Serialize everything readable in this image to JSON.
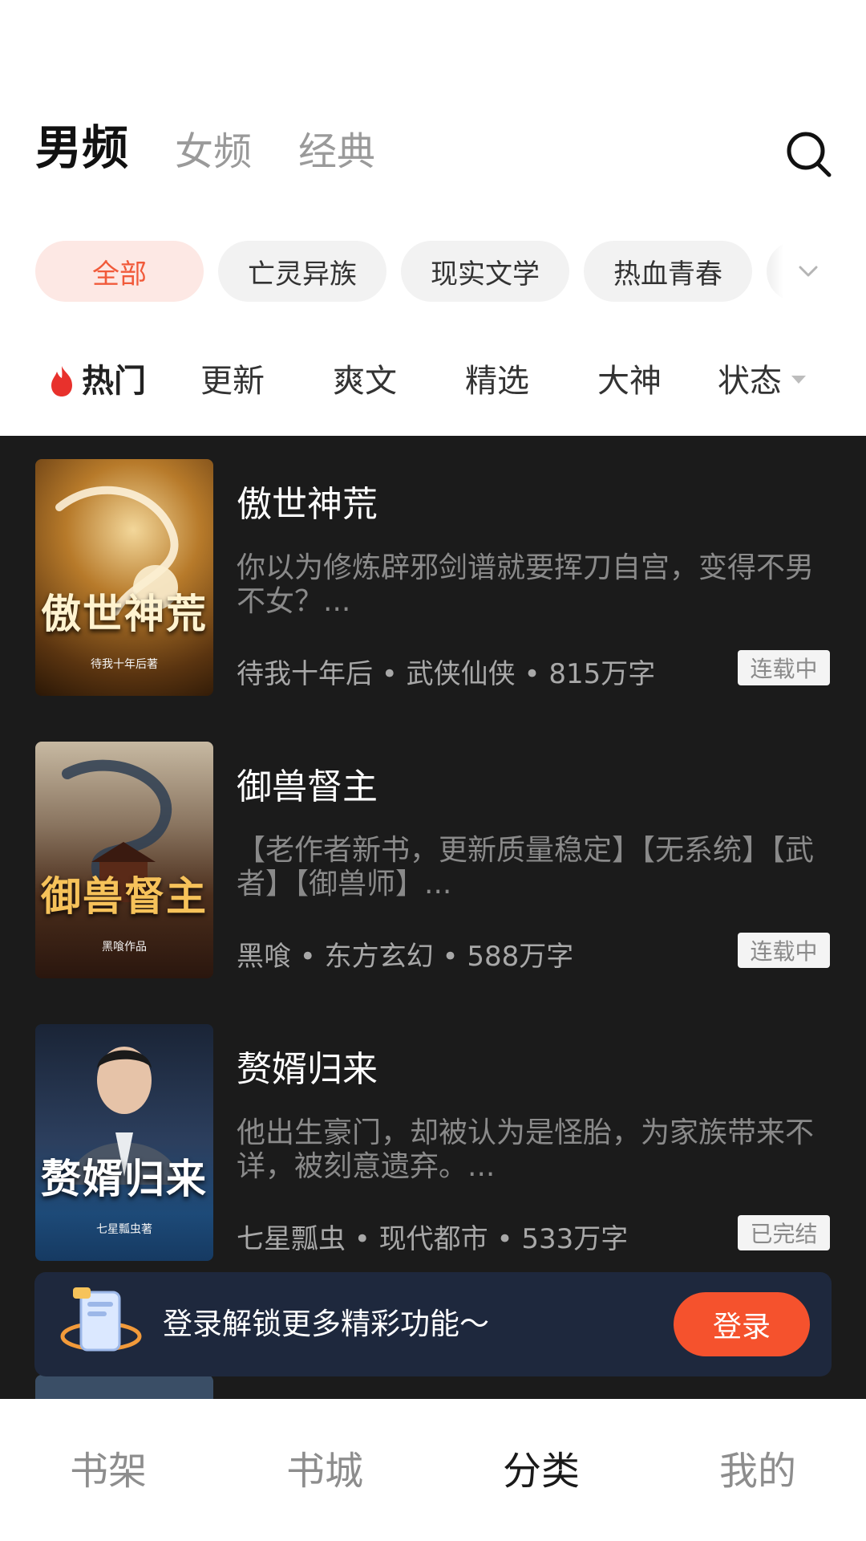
{
  "gender_tabs": [
    {
      "label": "男频",
      "active": true
    },
    {
      "label": "女频",
      "active": false
    },
    {
      "label": "经典",
      "active": false
    }
  ],
  "genre_chips": [
    {
      "label": "全部",
      "active": true
    },
    {
      "label": "亡灵异族",
      "active": false
    },
    {
      "label": "现实文学",
      "active": false
    },
    {
      "label": "热血青春",
      "active": false
    }
  ],
  "sort_tabs": {
    "hot": "热门",
    "update": "更新",
    "cool": "爽文",
    "featured": "精选",
    "master": "大神",
    "status": "状态"
  },
  "books": [
    {
      "title": "傲世神荒",
      "description": "你以为修炼辟邪剑谱就要挥刀自宫，变得不男不女？...",
      "meta": "待我十年后 • 武侠仙侠 • 815万字",
      "status": "连载中",
      "cover_title": "傲世神荒",
      "cover_author": "待我十年后著"
    },
    {
      "title": "御兽督主",
      "description": "【老作者新书，更新质量稳定】【无系统】【武者】【御兽师】...",
      "meta": "黑喰 • 东方玄幻 • 588万字",
      "status": "连载中",
      "cover_title": "御兽督主",
      "cover_author": "黑喰作品"
    },
    {
      "title": "赘婿归来",
      "description": "他出生豪门，却被认为是怪胎，为家族带来不详，被刻意遗弃。...",
      "meta": "七星瓢虫 • 现代都市 • 533万字",
      "status": "已完结",
      "cover_title": "赘婿归来",
      "cover_author": "七星瓢虫著"
    }
  ],
  "login_banner": {
    "text": "登录解锁更多精彩功能～",
    "button": "登录"
  },
  "bottom_nav": [
    {
      "label": "书架",
      "active": false
    },
    {
      "label": "书城",
      "active": false
    },
    {
      "label": "分类",
      "active": true
    },
    {
      "label": "我的",
      "active": false
    }
  ],
  "colors": {
    "accent": "#f5522d",
    "chip_active_text": "#f15a3a",
    "list_background": "#1b1b1b",
    "banner_background": "#1e283d"
  }
}
